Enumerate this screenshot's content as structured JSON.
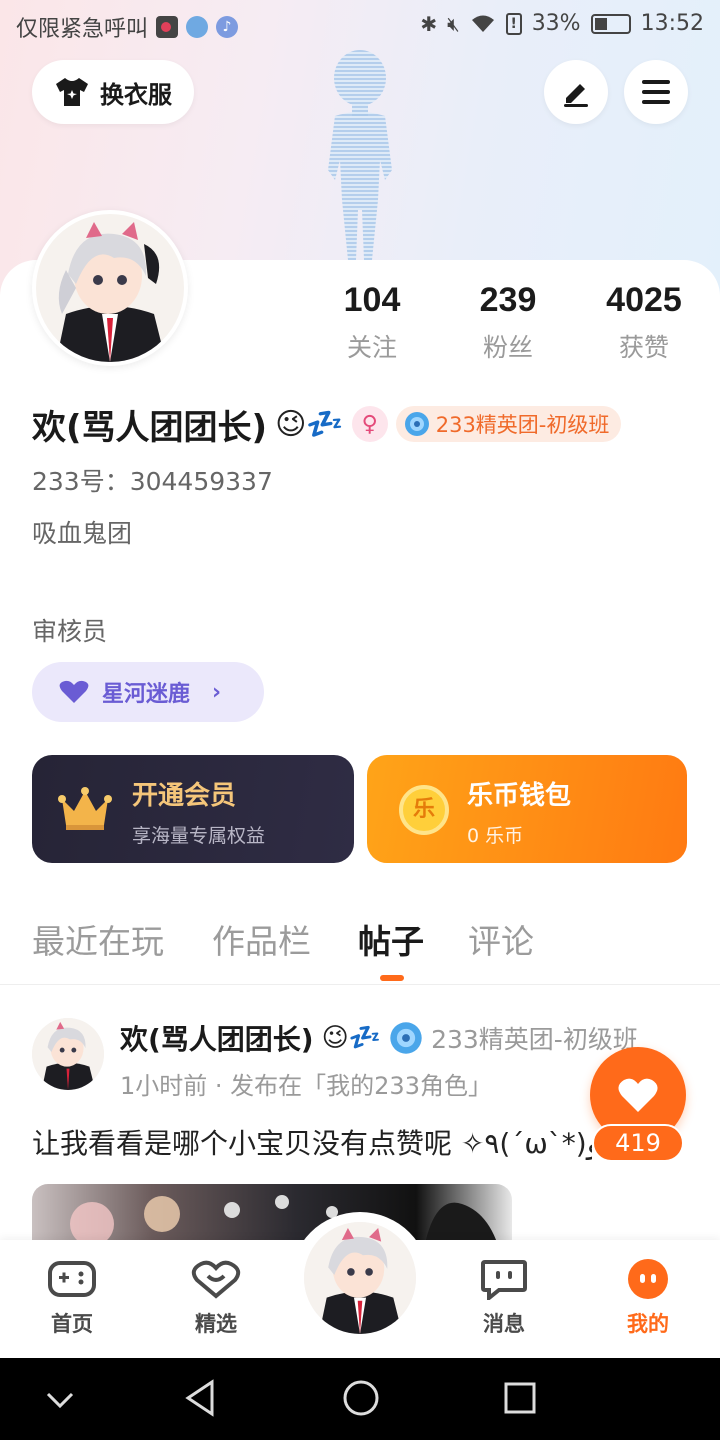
{
  "status_bar": {
    "carrier": "仅限紧急呼叫",
    "battery": "33%",
    "time": "13:52"
  },
  "header": {
    "outfit_button": "换衣服"
  },
  "profile": {
    "stats": [
      {
        "value": "104",
        "label": "关注"
      },
      {
        "value": "239",
        "label": "粉丝"
      },
      {
        "value": "4025",
        "label": "获赞"
      }
    ],
    "name": "欢(骂人团团长)",
    "emoji": "😉💤",
    "gender_symbol": "⚲",
    "guild": "233精英团-初级班",
    "uid": "233号：304459337",
    "bio": "吸血鬼团",
    "role": "审核员",
    "galaxy_pill": "星河迷鹿"
  },
  "cards": {
    "vip": {
      "title": "开通会员",
      "subtitle": "享海量专属权益"
    },
    "wallet": {
      "title": "乐币钱包",
      "subtitle": "0 乐币",
      "coin_char": "乐"
    }
  },
  "tabs": [
    {
      "label": "最近在玩"
    },
    {
      "label": "作品栏"
    },
    {
      "label": "帖子"
    },
    {
      "label": "评论"
    }
  ],
  "post": {
    "author": "欢(骂人团团长)",
    "emoji": "😉💤",
    "guild": "233精英团-初级班",
    "meta": "1小时前 · 发布在「我的233角色」",
    "text": "让我看看是哪个小宝贝没有点赞呢 ✧٩(ˊωˋ*)و✧",
    "likes": "419"
  },
  "bottom_nav": [
    {
      "label": "首页",
      "icon": "gamepad-icon"
    },
    {
      "label": "精选",
      "icon": "heart-chat-icon"
    },
    {
      "label": "消息",
      "icon": "message-icon"
    },
    {
      "label": "我的",
      "icon": "profile-face-icon"
    }
  ],
  "colors": {
    "accent": "#ff6a1a",
    "purple": "#6a5cd4",
    "vip_gold": "#f5c67a"
  }
}
